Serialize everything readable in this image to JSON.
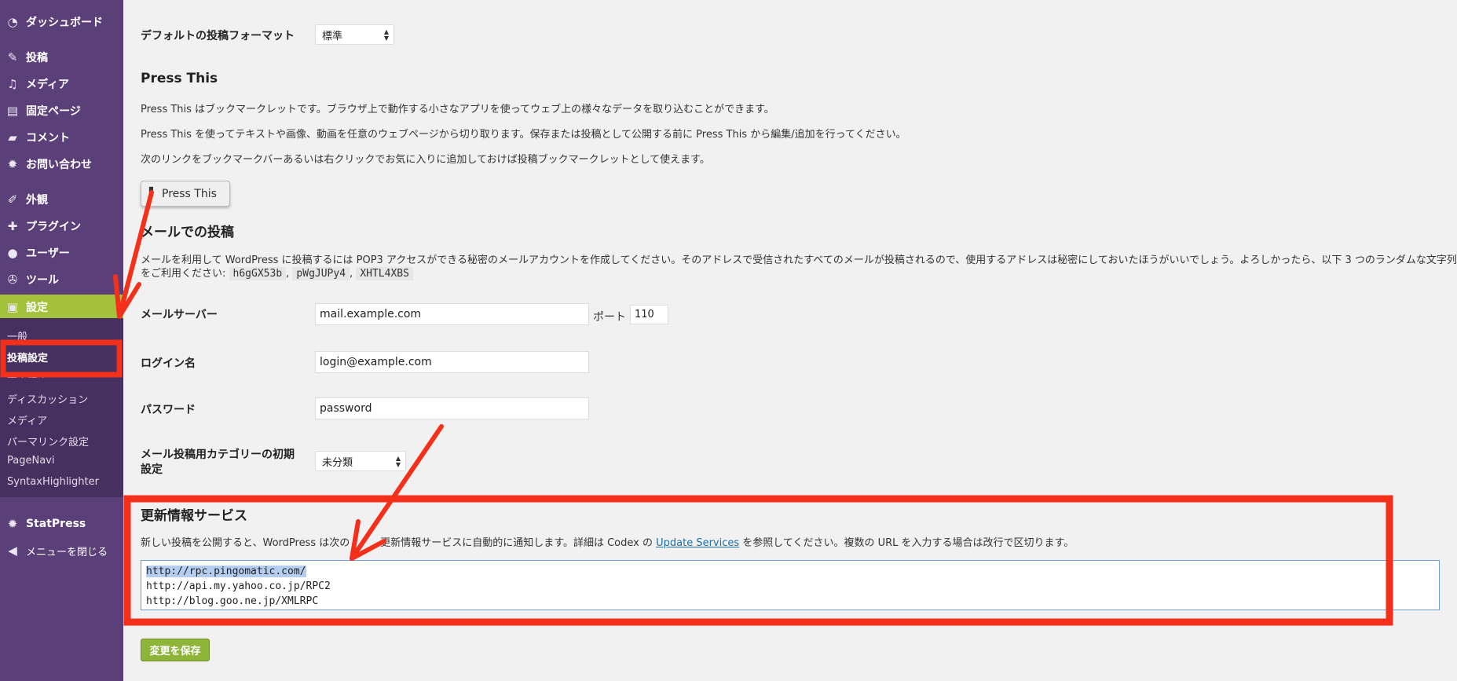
{
  "sidebar": {
    "items": [
      {
        "label": "ダッシュボード",
        "icon": "dashboard-icon",
        "glyph": "◔"
      },
      {
        "label": "投稿",
        "icon": "pin-icon",
        "glyph": "✎"
      },
      {
        "label": "メディア",
        "icon": "media-icon",
        "glyph": "♫"
      },
      {
        "label": "固定ページ",
        "icon": "pages-icon",
        "glyph": "▤"
      },
      {
        "label": "コメント",
        "icon": "comment-icon",
        "glyph": "▰"
      },
      {
        "label": "お問い合わせ",
        "icon": "gear-icon",
        "glyph": "✹"
      },
      {
        "label": "外観",
        "icon": "brush-icon",
        "glyph": "✐"
      },
      {
        "label": "プラグイン",
        "icon": "plugin-icon",
        "glyph": "✚"
      },
      {
        "label": "ユーザー",
        "icon": "user-icon",
        "glyph": "●"
      },
      {
        "label": "ツール",
        "icon": "wrench-icon",
        "glyph": "✇"
      },
      {
        "label": "設定",
        "icon": "settings-icon",
        "glyph": "▣"
      }
    ],
    "submenu": [
      "一般",
      "投稿設定",
      "表示設定",
      "ディスカッション",
      "メディア",
      "パーマリンク設定",
      "PageNavi",
      "SyntaxHighlighter"
    ],
    "bottom_items": [
      {
        "label": "StatPress",
        "icon": "stats-icon",
        "glyph": "✹"
      },
      {
        "label": "メニューを閉じる",
        "icon": "collapse-icon",
        "glyph": "◀"
      }
    ]
  },
  "main": {
    "default_format": {
      "label": "デフォルトの投稿フォーマット",
      "value": "標準"
    },
    "press_this": {
      "heading": "Press This",
      "p1": "Press This はブックマークレットです。ブラウザ上で動作する小さなアプリを使ってウェブ上の様々なデータを取り込むことができます。",
      "p2": "Press This を使ってテキストや画像、動画を任意のウェブページから切り取ります。保存または投稿として公開する前に Press This から編集/追加を行ってください。",
      "p3": "次のリンクをブックマークバーあるいは右クリックでお気に入りに追加しておけば投稿ブックマークレットとして使えます。",
      "button": "Press This"
    },
    "mail": {
      "heading": "メールでの投稿",
      "desc1": "メールを利用して WordPress に投稿するには POP3 アクセスができる秘密のメールアカウントを作成してください。そのアドレスで受信されたすべてのメールが投稿されるので、使用するアドレスは秘密にしておいたほうがいいでしょう。よろしかったら、以下 3 つのランダムな文字列",
      "desc2": "をご利用ください:",
      "codes": [
        "h6gGX53b",
        "pWgJUPy4",
        "XHTL4XBS"
      ],
      "server_label": "メールサーバー",
      "server_value": "mail.example.com",
      "port_label": "ポート",
      "port_value": "110",
      "login_label": "ログイン名",
      "login_value": "login@example.com",
      "password_label": "パスワード",
      "password_value": "password",
      "category_label": "メール投稿用カテゴリーの初期設定",
      "category_value": "未分類"
    },
    "update_services": {
      "heading": "更新情報サービス",
      "desc_before": "新しい投稿を公開すると、WordPress は次の",
      "desc_hidden": "サイト",
      "desc_mid": "更新情報サービスに自動的に通知します。詳細は Codex の ",
      "link": "Update Services",
      "desc_after": " を参照してください。複数の URL を入力する場合は改行で区切ります。",
      "urls": [
        "http://rpc.pingomatic.com/",
        "http://api.my.yahoo.co.jp/RPC2",
        "http://blog.goo.ne.jp/XMLRPC"
      ]
    },
    "save_button": "変更を保存"
  },
  "colors": {
    "sidebar": "#5b3f78",
    "submenu": "#46305f",
    "accent": "#a3c13a",
    "annotation": "#f5301a",
    "link": "#1e6fa8"
  }
}
